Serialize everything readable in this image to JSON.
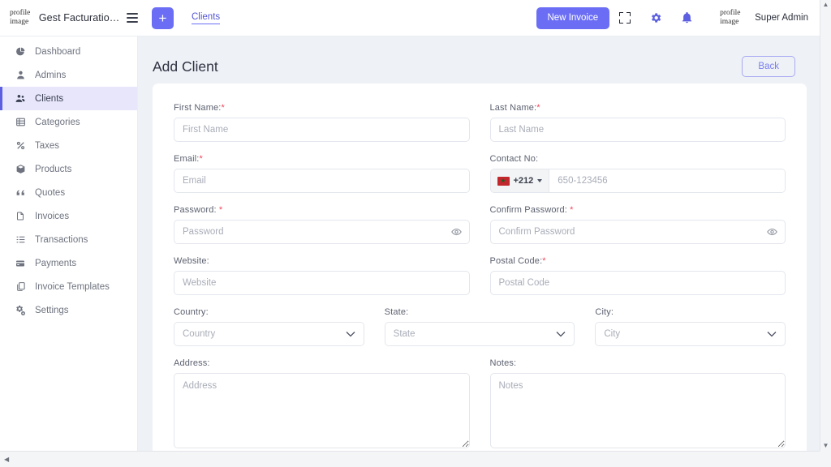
{
  "topbar": {
    "logo_alt": "profile\nimage",
    "brand": "Gest Facturatio…",
    "menu_icon": "hamburger-icon",
    "add_label": "+",
    "tab_label": "Clients",
    "new_invoice_label": "New Invoice",
    "fullscreen_icon": "fullscreen-icon",
    "settings_icon": "gear-icon",
    "notifications_icon": "bell-icon",
    "avatar_alt": "profile\nimage",
    "user_name": "Super Admin"
  },
  "sidebar": {
    "items": [
      {
        "label": "Dashboard",
        "icon": "pie-chart-icon",
        "active": false
      },
      {
        "label": "Admins",
        "icon": "user-icon",
        "active": false
      },
      {
        "label": "Clients",
        "icon": "users-icon",
        "active": true
      },
      {
        "label": "Categories",
        "icon": "grid-list-icon",
        "active": false
      },
      {
        "label": "Taxes",
        "icon": "percent-icon",
        "active": false
      },
      {
        "label": "Products",
        "icon": "box-icon",
        "active": false
      },
      {
        "label": "Quotes",
        "icon": "quote-icon",
        "active": false
      },
      {
        "label": "Invoices",
        "icon": "document-icon",
        "active": false
      },
      {
        "label": "Transactions",
        "icon": "list-ordered-icon",
        "active": false
      },
      {
        "label": "Payments",
        "icon": "credit-card-icon",
        "active": false
      },
      {
        "label": "Invoice Templates",
        "icon": "copy-icon",
        "active": false
      },
      {
        "label": "Settings",
        "icon": "gears-icon",
        "active": false
      }
    ]
  },
  "page": {
    "title": "Add Client",
    "back_label": "Back"
  },
  "form": {
    "first_name": {
      "label": "First Name:",
      "required": true,
      "placeholder": "First Name",
      "value": ""
    },
    "last_name": {
      "label": "Last Name:",
      "required": true,
      "placeholder": "Last Name",
      "value": ""
    },
    "email": {
      "label": "Email:",
      "required": true,
      "placeholder": "Email",
      "value": ""
    },
    "contact_no": {
      "label": "Contact No:",
      "required": false,
      "placeholder": "650-123456",
      "value": "",
      "dial_code": "+212",
      "flag": "morocco-flag-icon"
    },
    "password": {
      "label": "Password: ",
      "required": true,
      "placeholder": "Password",
      "value": "",
      "toggle_icon": "eye-icon"
    },
    "confirm_password": {
      "label": "Confirm Password: ",
      "required": true,
      "placeholder": "Confirm Password",
      "value": "",
      "toggle_icon": "eye-icon"
    },
    "website": {
      "label": "Website:",
      "required": false,
      "placeholder": "Website",
      "value": ""
    },
    "postal_code": {
      "label": "Postal Code:",
      "required": true,
      "placeholder": "Postal Code",
      "value": ""
    },
    "country": {
      "label": "Country:",
      "required": false,
      "placeholder": "Country",
      "value": "Country"
    },
    "state": {
      "label": "State:",
      "required": false,
      "placeholder": "State",
      "value": "State"
    },
    "city": {
      "label": "City:",
      "required": false,
      "placeholder": "City",
      "value": "City"
    },
    "address": {
      "label": "Address:",
      "required": false,
      "placeholder": "Address",
      "value": ""
    },
    "notes": {
      "label": "Notes:",
      "required": false,
      "placeholder": "Notes",
      "value": ""
    }
  },
  "colors": {
    "accent": "#6b6ef4",
    "accent_dark": "#5356d6",
    "active_bg": "#e7e6fb",
    "required": "#f3455c",
    "page_bg": "#eef1f6",
    "flag_red": "#c1272d"
  },
  "scrollbars": {
    "v_up": "▲",
    "v_down": "▼",
    "h_left": "◀",
    "h_right": "▶"
  }
}
